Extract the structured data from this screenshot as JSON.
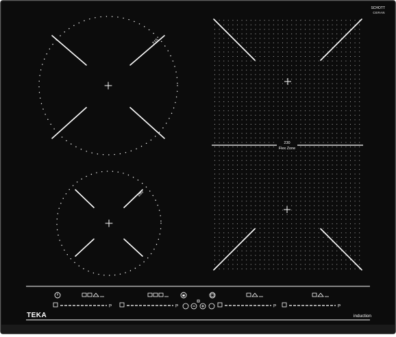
{
  "product": {
    "glass_brand_line1": "SCHOTT",
    "glass_brand_line2": "CERAN",
    "brand": "TEKA",
    "technology": "induction"
  },
  "zones": {
    "top_left_size": "215",
    "bottom_left_size": "160",
    "flex_size": "230",
    "flex_label": "Flex Zone"
  },
  "controls": {
    "plus_symbol": "P",
    "power_symbol": "⏻"
  },
  "colors": {
    "glass": "#0c0c0c",
    "markings": "#ffffff"
  }
}
